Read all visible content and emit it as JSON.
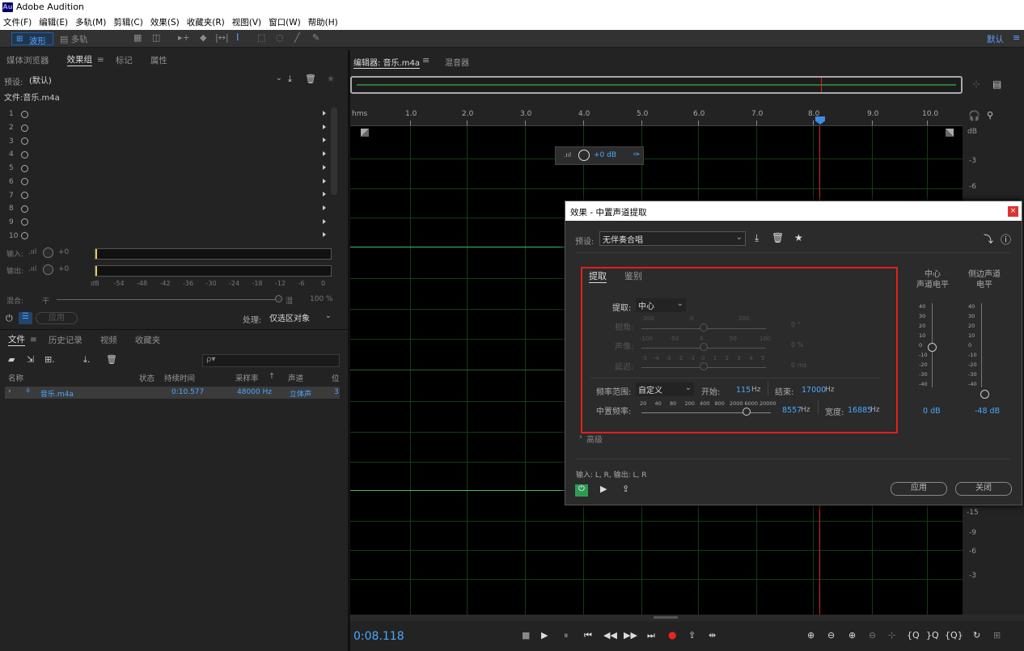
{
  "app": {
    "logo": "Au",
    "title": "Adobe Audition"
  },
  "menu": [
    "文件(F)",
    "编辑(E)",
    "多轨(M)",
    "剪辑(C)",
    "效果(S)",
    "收藏夹(R)",
    "视图(V)",
    "窗口(W)",
    "帮助(H)"
  ],
  "toolbar": {
    "waveform": "波形",
    "multitrack": "多轨",
    "workspace": "默认"
  },
  "left_tabs": [
    "媒体浏览器",
    "效果组",
    "标记",
    "属性"
  ],
  "rack": {
    "preset_label": "预设:",
    "preset_value": "(默认)",
    "file": "文件:音乐.m4a",
    "slots": [
      "1",
      "2",
      "3",
      "4",
      "5",
      "6",
      "7",
      "8",
      "9",
      "10"
    ],
    "input_label": "输入:",
    "output_label": "输出:",
    "input_val": "+0",
    "output_val": "+0",
    "mix_label": "混合:",
    "dry": "干",
    "wet": "湿",
    "mix_pct": "100 %",
    "apply": "应用",
    "process_label": "处理:",
    "process_value": "仅选区对象",
    "scale": [
      "dB",
      "-54",
      "-48",
      "-42",
      "-36",
      "-30",
      "-24",
      "-18",
      "-12",
      "-6",
      "0"
    ]
  },
  "files": {
    "tabs": [
      "文件",
      "历史记录",
      "视频",
      "收藏夹"
    ],
    "search_placeholder": "ρ▾",
    "cols": [
      "名称",
      "状态",
      "持续时间",
      "采样率",
      "声道",
      "位"
    ],
    "row": {
      "name": "音乐.m4a",
      "duration": "0:10.577",
      "rate": "48000 Hz",
      "channels": "立体声",
      "bits": "3"
    }
  },
  "editor": {
    "tab": "编辑器: 音乐.m4a",
    "mixer": "混音器",
    "ruler": [
      "hms",
      "1.0",
      "2.0",
      "3.0",
      "4.0",
      "5.0",
      "6.0",
      "7.0",
      "8.0",
      "9.0",
      "10.0"
    ],
    "hud_gain": "+0 dB",
    "db_unit": "dB",
    "db_top": [
      "-3",
      "-6"
    ],
    "db_bottom": [
      "-15",
      "-9",
      "-6",
      "-3"
    ],
    "time": "0:08.118"
  },
  "dialog": {
    "title": "效果 - 中置声道提取",
    "preset_label": "预设:",
    "preset_value": "无伴奏合唱",
    "tabs": [
      "提取",
      "鉴别"
    ],
    "extract_label": "提取:",
    "extract_value": "中心",
    "angle_label": "相角:",
    "angle_ticks": [
      "-200",
      "0",
      "200"
    ],
    "angle_val": "0 °",
    "pan_label": "声像:",
    "pan_ticks": [
      "-100",
      "-50",
      "0",
      "50",
      "100"
    ],
    "pan_val": "0 %",
    "delay_label": "延迟:",
    "delay_ticks": [
      "-5",
      "-4",
      "-3",
      "-2",
      "-1",
      "0",
      "1",
      "2",
      "3",
      "4",
      "5"
    ],
    "delay_val": "0 ms",
    "freq_range_label": "频率范围:",
    "freq_range_value": "自定义",
    "start_label": "开始:",
    "start_val": "115",
    "end_label": "结束:",
    "end_val": "17000",
    "hz": "Hz",
    "center_freq_label": "中置频率:",
    "cf_ticks": [
      "20",
      "40",
      "80",
      "200",
      "400",
      "800",
      "2000",
      "6000",
      "20000"
    ],
    "cf_val": "8557",
    "width_label": "宽度:",
    "width_val": "16885",
    "advanced": "高级",
    "center_level_title": "中心\n声道电平",
    "side_level_title": "侧边声道\n电平",
    "level_ticks": [
      "40",
      "30",
      "20",
      "10",
      "0",
      "-10",
      "-20",
      "-30",
      "-40"
    ],
    "center_db": "0 dB",
    "side_db": "-48 dB",
    "io": "输入: L, R,  输出: L, R",
    "apply": "应用",
    "close": "关闭",
    "highlight_color": "#e0201a"
  }
}
